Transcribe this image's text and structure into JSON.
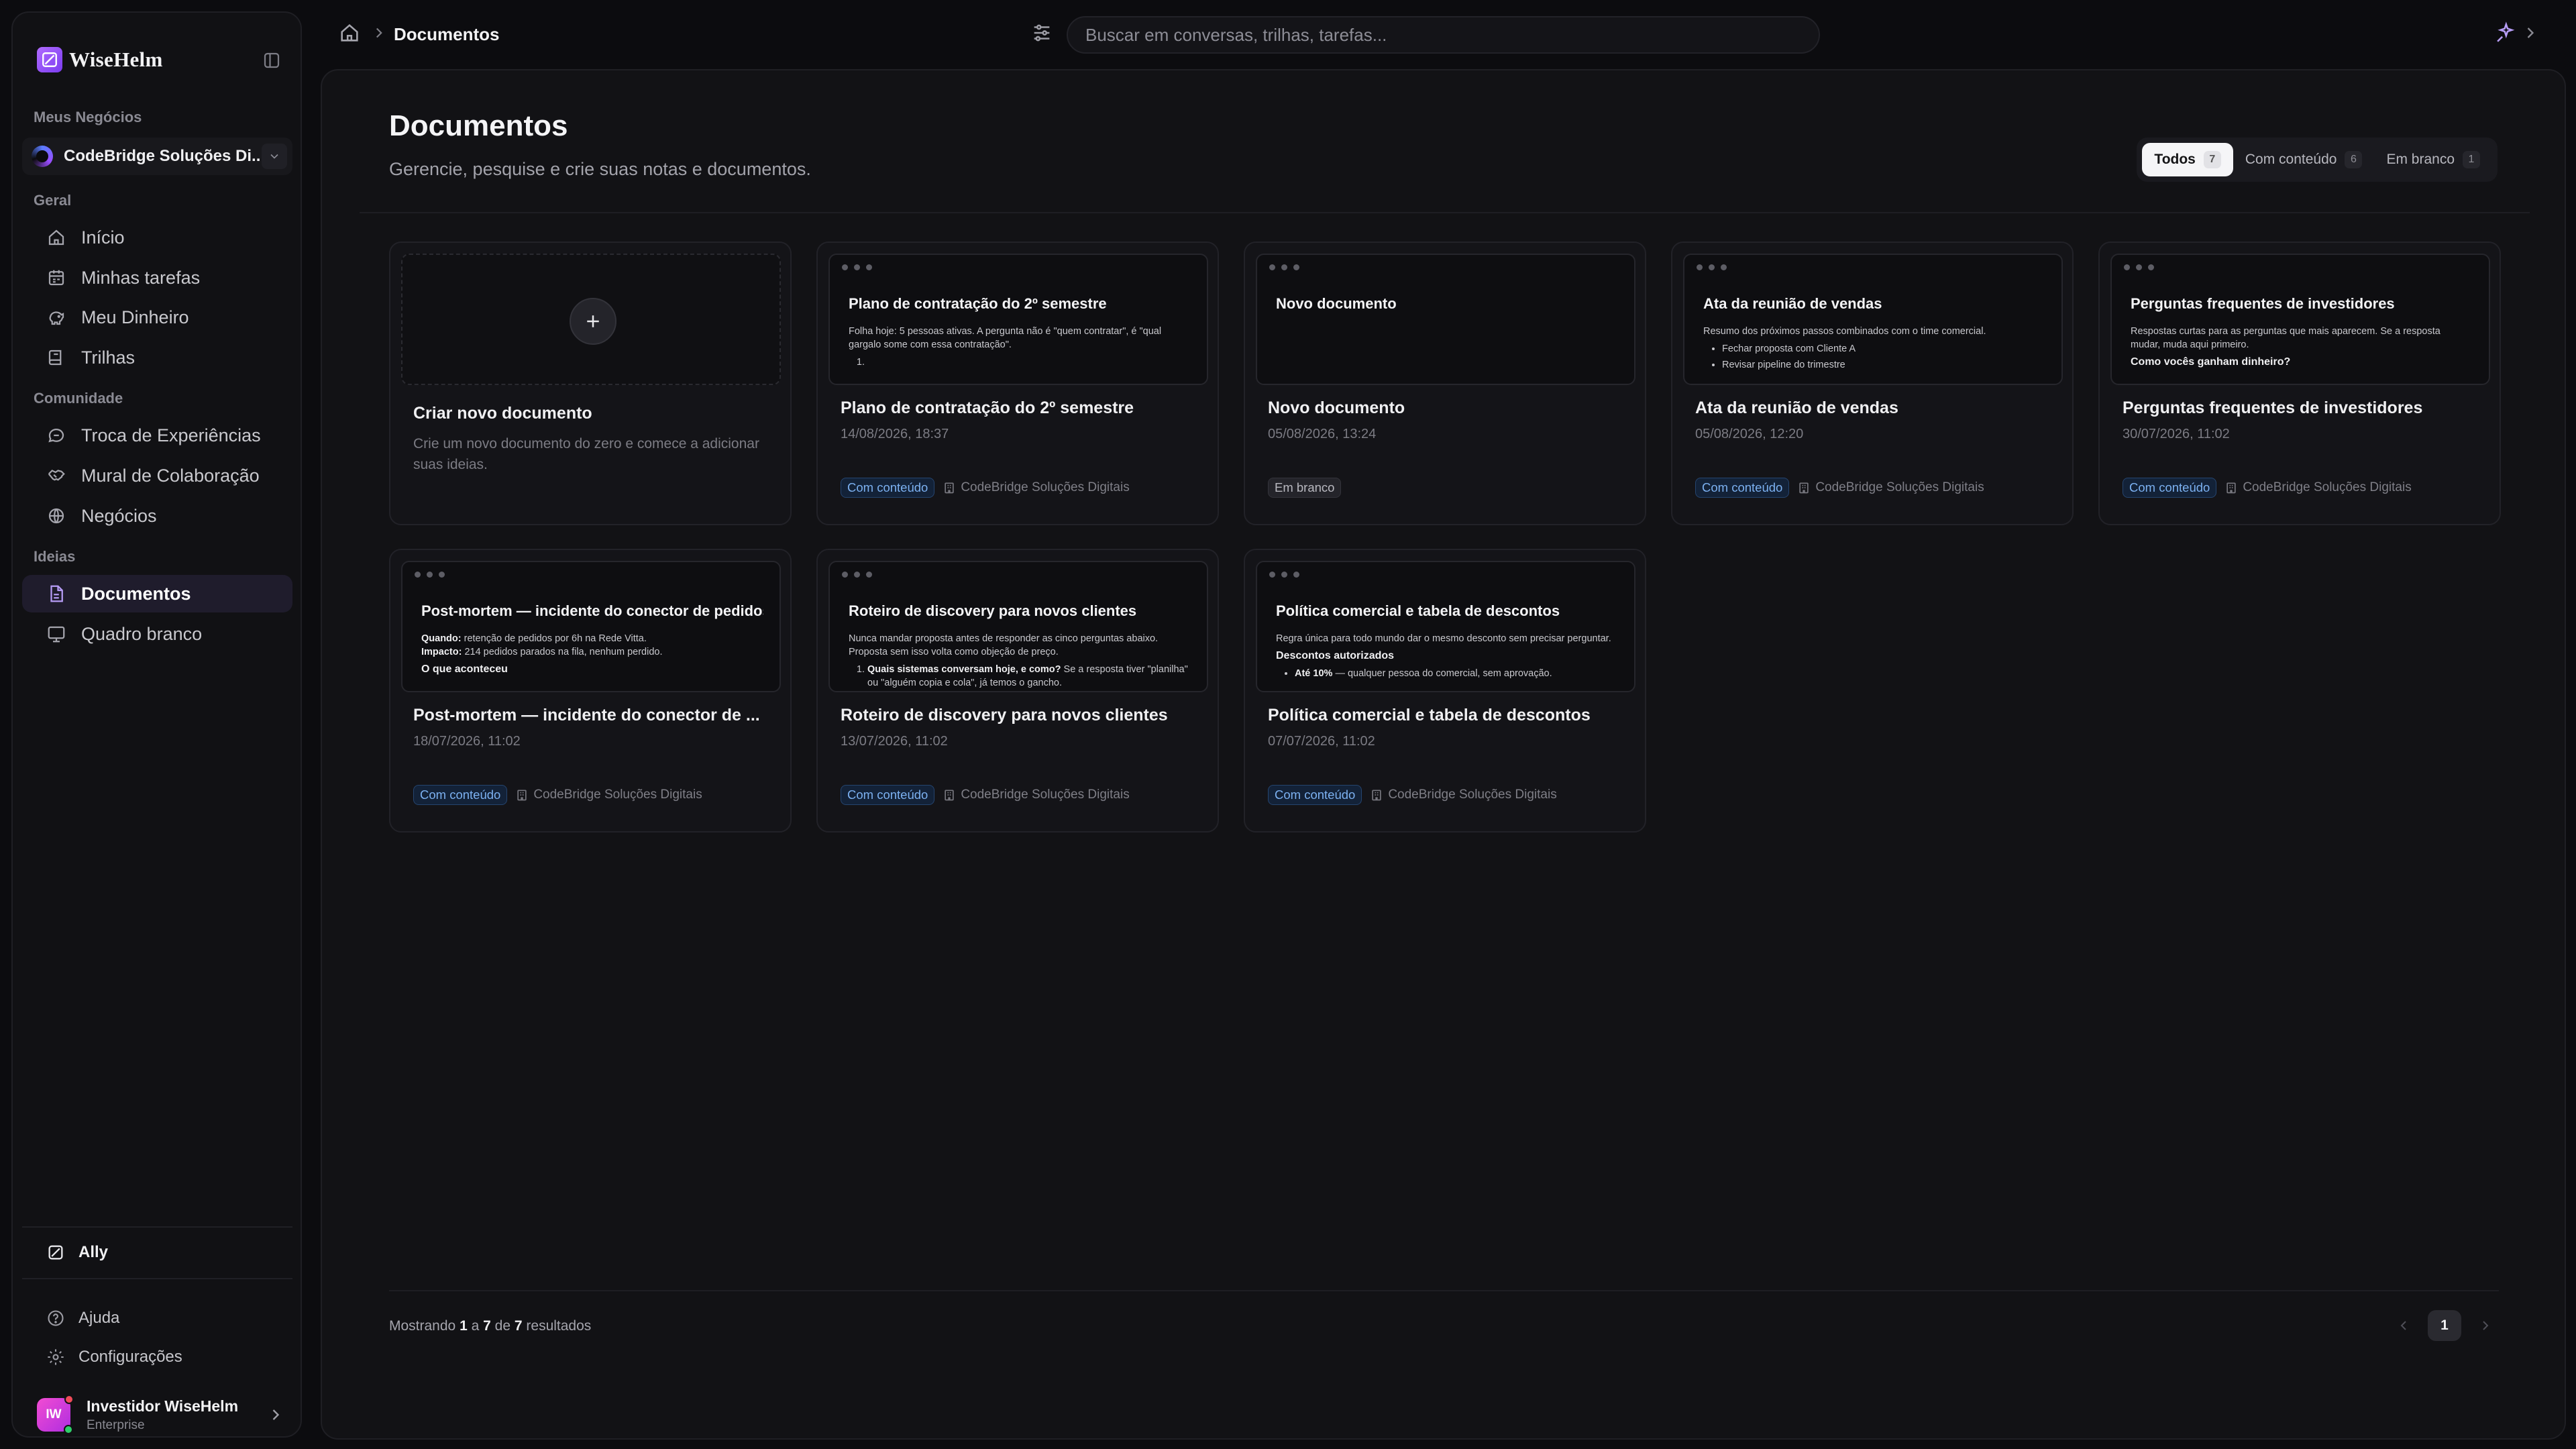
{
  "brand": {
    "name": "WiseHelm"
  },
  "sidebar": {
    "business_section": "Meus Negócios",
    "business_name": "CodeBridge Soluções Di...",
    "sections": {
      "general": "Geral",
      "community": "Comunidade",
      "ideas": "Ideias"
    },
    "items": [
      {
        "label": "Início",
        "icon": "home-icon"
      },
      {
        "label": "Minhas tarefas",
        "icon": "calendar-icon"
      },
      {
        "label": "Meu Dinheiro",
        "icon": "piggy-bank-icon"
      },
      {
        "label": "Trilhas",
        "icon": "book-icon"
      },
      {
        "label": "Troca de Experiências",
        "icon": "chat-icon"
      },
      {
        "label": "Mural de Colaboração",
        "icon": "handshake-icon"
      },
      {
        "label": "Negócios",
        "icon": "globe-icon"
      },
      {
        "label": "Documentos",
        "icon": "document-icon",
        "active": true
      },
      {
        "label": "Quadro branco",
        "icon": "monitor-icon"
      }
    ],
    "ally": "Ally",
    "help": "Ajuda",
    "settings": "Configurações",
    "user": {
      "initials": "IW",
      "name": "Investidor WiseHelm",
      "plan": "Enterprise"
    }
  },
  "topbar": {
    "breadcrumb_current": "Documentos",
    "search_placeholder": "Buscar em conversas, trilhas, tarefas..."
  },
  "page": {
    "title": "Documentos",
    "subtitle": "Gerencie, pesquise e crie suas notas e documentos.",
    "filters": [
      {
        "label": "Todos",
        "count": "7",
        "active": true
      },
      {
        "label": "Com conteúdo",
        "count": "6"
      },
      {
        "label": "Em branco",
        "count": "1"
      }
    ]
  },
  "new_card": {
    "title": "Criar novo documento",
    "description": "Crie um novo documento do zero e comece a adicionar suas ideias."
  },
  "documents": [
    {
      "preview_title": "Plano de contratação do 2º semestre",
      "preview_lines": [
        "Folha hoje: 5 pessoas ativas. A pergunta não é \"quem contratar\", é \"qual gargalo some com essa contratação\"."
      ],
      "title": "Plano de contratação do 2º semestre",
      "date": "14/08/2026, 18:37",
      "status": "Com conteúdo",
      "business": "CodeBridge Soluções Digitais"
    },
    {
      "preview_title": "Novo documento",
      "title": "Novo documento",
      "date": "05/08/2026, 13:24",
      "status": "Em branco",
      "business": ""
    },
    {
      "preview_title": "Ata da reunião de vendas",
      "preview_lines": [
        "Resumo dos próximos passos combinados com o time comercial."
      ],
      "preview_bullets": [
        "Fechar proposta com Cliente A",
        "Revisar pipeline do trimestre"
      ],
      "title": "Ata da reunião de vendas",
      "date": "05/08/2026, 12:20",
      "status": "Com conteúdo",
      "business": "CodeBridge Soluções Digitais"
    },
    {
      "preview_title": "Perguntas frequentes de investidores",
      "preview_lines": [
        "Respostas curtas para as perguntas que mais aparecem. Se a resposta mudar, muda aqui primeiro."
      ],
      "preview_heading": "Como vocês ganham dinheiro?",
      "title": "Perguntas frequentes de investidores",
      "date": "30/07/2026, 11:02",
      "status": "Com conteúdo",
      "business": "CodeBridge Soluções Digitais"
    },
    {
      "preview_title": "Post-mortem — incidente do conector de pedidos",
      "preview_when_label": "Quando:",
      "preview_when": "retenção de pedidos por 6h na Rede Vitta.",
      "preview_impact_label": "Impacto:",
      "preview_impact": "214 pedidos parados na fila, nenhum perdido.",
      "preview_heading": "O que aconteceu",
      "title": "Post-mortem — incidente do conector de ...",
      "date": "18/07/2026, 11:02",
      "status": "Com conteúdo",
      "business": "CodeBridge Soluções Digitais"
    },
    {
      "preview_title": "Roteiro de discovery para novos clientes",
      "preview_lines": [
        "Nunca mandar proposta antes de responder as cinco perguntas abaixo. Proposta sem isso volta como objeção de preço."
      ],
      "preview_q_bold": "Quais sistemas conversam hoje, e como?",
      "preview_q_rest": "Se a resposta tiver \"planilha\" ou \"alguém copia e cola\", já temos o gancho.",
      "title": "Roteiro de discovery para novos clientes",
      "date": "13/07/2026, 11:02",
      "status": "Com conteúdo",
      "business": "CodeBridge Soluções Digitais"
    },
    {
      "preview_title": "Política comercial e tabela de descontos",
      "preview_lines": [
        "Regra única para todo mundo dar o mesmo desconto sem precisar perguntar."
      ],
      "preview_heading": "Descontos autorizados",
      "preview_item_bold": "Até 10%",
      "preview_item_rest": "— qualquer pessoa do comercial, sem aprovação.",
      "title": "Política comercial e tabela de descontos",
      "date": "07/07/2026, 11:02",
      "status": "Com conteúdo",
      "business": "CodeBridge Soluções Digitais"
    }
  ],
  "pagination": {
    "prefix": "Mostrando",
    "from": "1",
    "to_word": "a",
    "to": "7",
    "of_word": "de",
    "total": "7",
    "suffix": "resultados",
    "current_page": "1"
  }
}
